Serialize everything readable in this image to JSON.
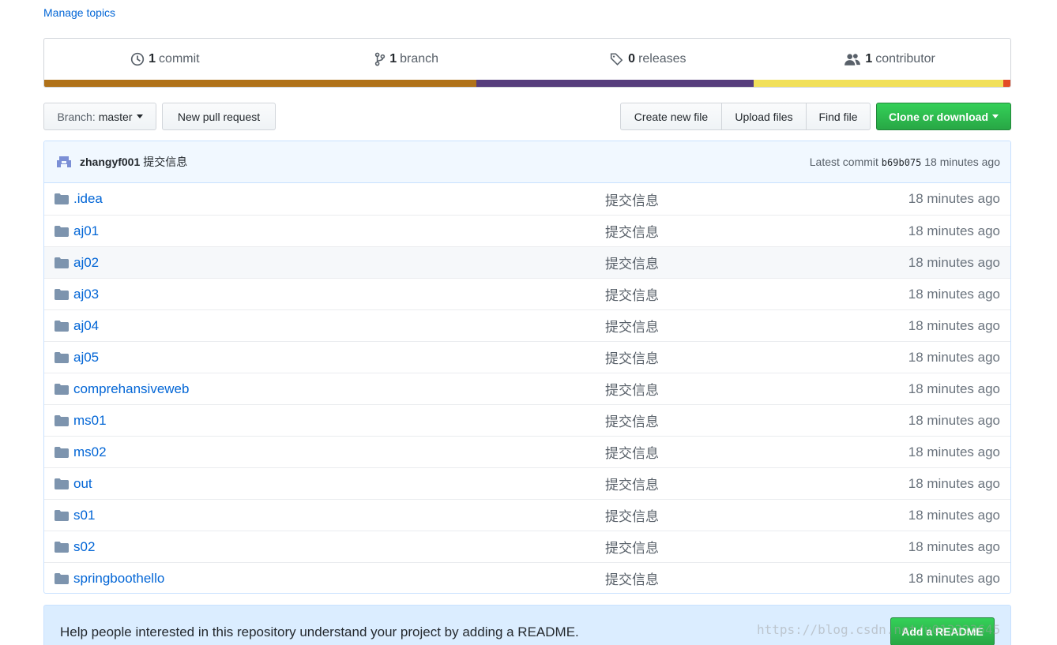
{
  "topics": {
    "manage_label": "Manage topics"
  },
  "summary": {
    "items": [
      {
        "icon": "history-icon",
        "count": "1",
        "label": "commit"
      },
      {
        "icon": "git-branch-icon",
        "count": "1",
        "label": "branch"
      },
      {
        "icon": "tag-icon",
        "count": "0",
        "label": "releases"
      },
      {
        "icon": "people-icon",
        "count": "1",
        "label": "contributor"
      }
    ],
    "languages": [
      {
        "color": "#b07219",
        "share": 44.7
      },
      {
        "color": "#563d7c",
        "share": 28.7
      },
      {
        "color": "#f1e05a",
        "share": 25.9
      },
      {
        "color": "#e34c26",
        "share": 0.7
      }
    ]
  },
  "toolbar": {
    "branch_prefix": "Branch:",
    "branch_name": "master",
    "new_pull_request": "New pull request",
    "create_new_file": "Create new file",
    "upload_files": "Upload files",
    "find_file": "Find file",
    "clone_or_download": "Clone or download"
  },
  "commit": {
    "author": "zhangyf001",
    "message": "提交信息",
    "latest_label": "Latest commit",
    "sha": "b69b075",
    "age": "18 minutes ago"
  },
  "files": [
    {
      "name": ".idea",
      "message": "提交信息",
      "age": "18 minutes ago"
    },
    {
      "name": "aj01",
      "message": "提交信息",
      "age": "18 minutes ago"
    },
    {
      "name": "aj02",
      "message": "提交信息",
      "age": "18 minutes ago"
    },
    {
      "name": "aj03",
      "message": "提交信息",
      "age": "18 minutes ago"
    },
    {
      "name": "aj04",
      "message": "提交信息",
      "age": "18 minutes ago"
    },
    {
      "name": "aj05",
      "message": "提交信息",
      "age": "18 minutes ago"
    },
    {
      "name": "comprehansiveweb",
      "message": "提交信息",
      "age": "18 minutes ago"
    },
    {
      "name": "ms01",
      "message": "提交信息",
      "age": "18 minutes ago"
    },
    {
      "name": "ms02",
      "message": "提交信息",
      "age": "18 minutes ago"
    },
    {
      "name": "out",
      "message": "提交信息",
      "age": "18 minutes ago"
    },
    {
      "name": "s01",
      "message": "提交信息",
      "age": "18 minutes ago"
    },
    {
      "name": "s02",
      "message": "提交信息",
      "age": "18 minutes ago"
    },
    {
      "name": "springboothello",
      "message": "提交信息",
      "age": "18 minutes ago"
    }
  ],
  "readme": {
    "text": "Help people interested in this repository understand your project by adding a README.",
    "button": "Add a README"
  },
  "watermark": "https://blog.csdn.net/u013323645",
  "colors": {
    "link": "#0366d6",
    "green": "#28a745",
    "folder": "#79b8ff"
  }
}
